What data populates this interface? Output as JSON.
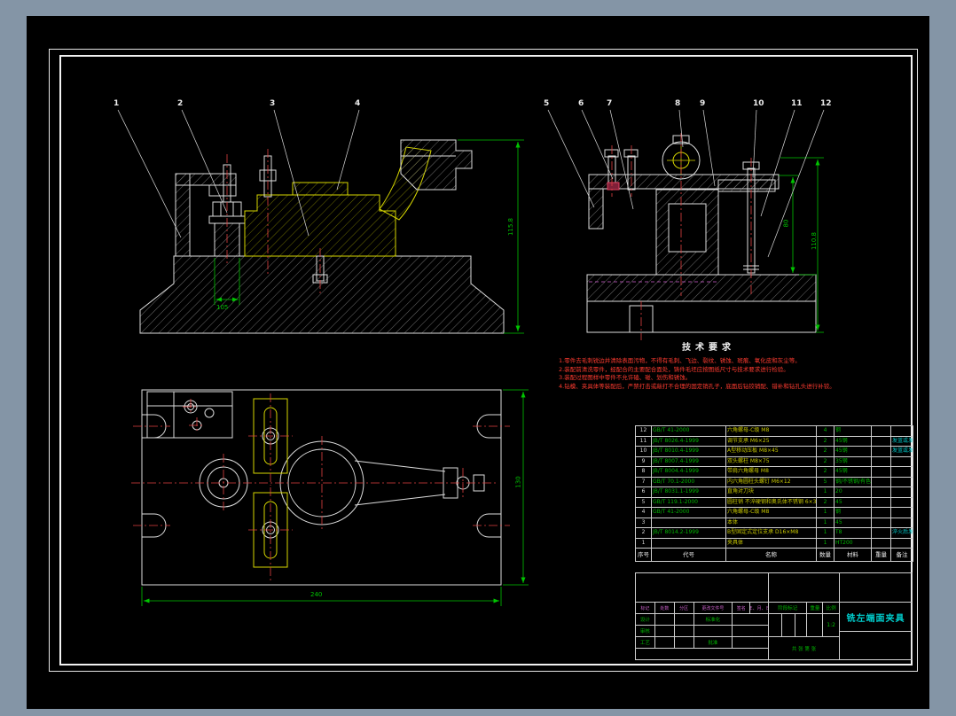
{
  "colors": {
    "surround": "#8495a6",
    "paper": "#000000",
    "frame": "#f2f2f2",
    "geometry": "#dcdcdc",
    "part_yellow": "#d6d600",
    "centerline_red": "#e04040",
    "phantom_magenta": "#d060d0",
    "dimension_green": "#00c400",
    "table_green": "#00b400",
    "name_yellow": "#c8c800",
    "remark_cyan": "#00c8c8",
    "title_cyan": "#00d0d0",
    "req_red": "#ff3b30"
  },
  "balloons": {
    "front": [
      "1",
      "2",
      "3",
      "4"
    ],
    "side": [
      "5",
      "6",
      "7",
      "8",
      "9",
      "10",
      "11",
      "12"
    ]
  },
  "dimensions": {
    "front_height": "115.8",
    "front_base": "105",
    "side_inner": "80",
    "side_outer": "110.8",
    "plan_width": "240",
    "plan_height": "130"
  },
  "tech_requirements": {
    "title": "技术要求",
    "lines": [
      "1.零件去毛刺锐边并清除表面污物，不得有毛刺、飞边、裂纹、锈蚀、斑痕、氧化皮和灰尘等。",
      "2.装配前清洗零件，经配合的主要配合面处，铸件毛坯应按图纸尺寸与技术要求进行检验。",
      "3.装配过程图样中零件不允许磕、碰、划伤和锈蚀。",
      "4.钻模、夹具体等装配后，严禁打击或敲打不合理的固定销孔子，底面后钻铰销配、错补和钻孔头进行补铰。"
    ]
  },
  "parts_table": {
    "headers": {
      "num": "序号",
      "code": "代号",
      "name": "名称",
      "qty": "数量",
      "material": "材料",
      "weight": "重量",
      "remark": "备注"
    },
    "rows": [
      {
        "num": "12",
        "code": "GB/T 41-2000",
        "name": "六角螺母-C级 M8",
        "qty": "4",
        "material": "钢",
        "weight": "",
        "remark": ""
      },
      {
        "num": "11",
        "code": "JB/T 8026.4-1999",
        "name": "调节支承 M6×25",
        "qty": "2",
        "material": "45钢",
        "weight": "",
        "remark": "发蓝或发黑处理"
      },
      {
        "num": "10",
        "code": "JB/T 8010.4-1999",
        "name": "A型移动压板 M8×45",
        "qty": "2",
        "material": "45钢",
        "weight": "",
        "remark": "发蓝或发黑处理"
      },
      {
        "num": "9",
        "code": "JB/T 8007.4-1999",
        "name": "双头螺柱 M8×75",
        "qty": "2",
        "material": "35钢",
        "weight": "",
        "remark": ""
      },
      {
        "num": "8",
        "code": "JB/T 8004.4-1999",
        "name": "带肩六角螺母 M8",
        "qty": "2",
        "material": "45钢",
        "weight": "",
        "remark": ""
      },
      {
        "num": "7",
        "code": "GB/T 70.1-2000",
        "name": "内六角圆柱头螺钉 M6×12",
        "qty": "5",
        "material": "钢/不锈钢/有色金属",
        "weight": "",
        "remark": ""
      },
      {
        "num": "6",
        "code": "JB/T 8031.1-1999",
        "name": "直角对刀块",
        "qty": "1",
        "material": "20",
        "weight": "",
        "remark": ""
      },
      {
        "num": "5",
        "code": "GB/T 119.1-2000",
        "name": "圆柱销 不淬硬钢和奥氏体不锈钢 6×30",
        "qty": "2",
        "material": "45",
        "weight": "",
        "remark": ""
      },
      {
        "num": "4",
        "code": "GB/T 41-2000",
        "name": "六角螺母-C级 M8",
        "qty": "1",
        "material": "钢",
        "weight": "",
        "remark": ""
      },
      {
        "num": "3",
        "code": "",
        "name": "本体",
        "qty": "1",
        "material": "45",
        "weight": "",
        "remark": ""
      },
      {
        "num": "2",
        "code": "JB/T 8014.2-1999",
        "name": "B型固定式定位支承 D16×M8",
        "qty": "1",
        "material": "T8",
        "weight": "",
        "remark": "淬火后发黑处理"
      },
      {
        "num": "1",
        "code": "",
        "name": "夹具体",
        "qty": "1",
        "material": "HT200",
        "weight": "",
        "remark": ""
      }
    ]
  },
  "title_block": {
    "drawing_title": "铣左端面夹具",
    "revision_headers": [
      "标记",
      "处数",
      "分区",
      "更改文件号",
      "签名",
      "年、月、日"
    ],
    "roles": {
      "design": "设计",
      "check": "审核",
      "process": "工艺",
      "standard": "标准化",
      "approve": "批准"
    },
    "stage_label": "阶段标记",
    "weight_label": "重量",
    "scale_label": "比例",
    "scale_value": "1:2",
    "sheets": "共  张  第  张"
  }
}
